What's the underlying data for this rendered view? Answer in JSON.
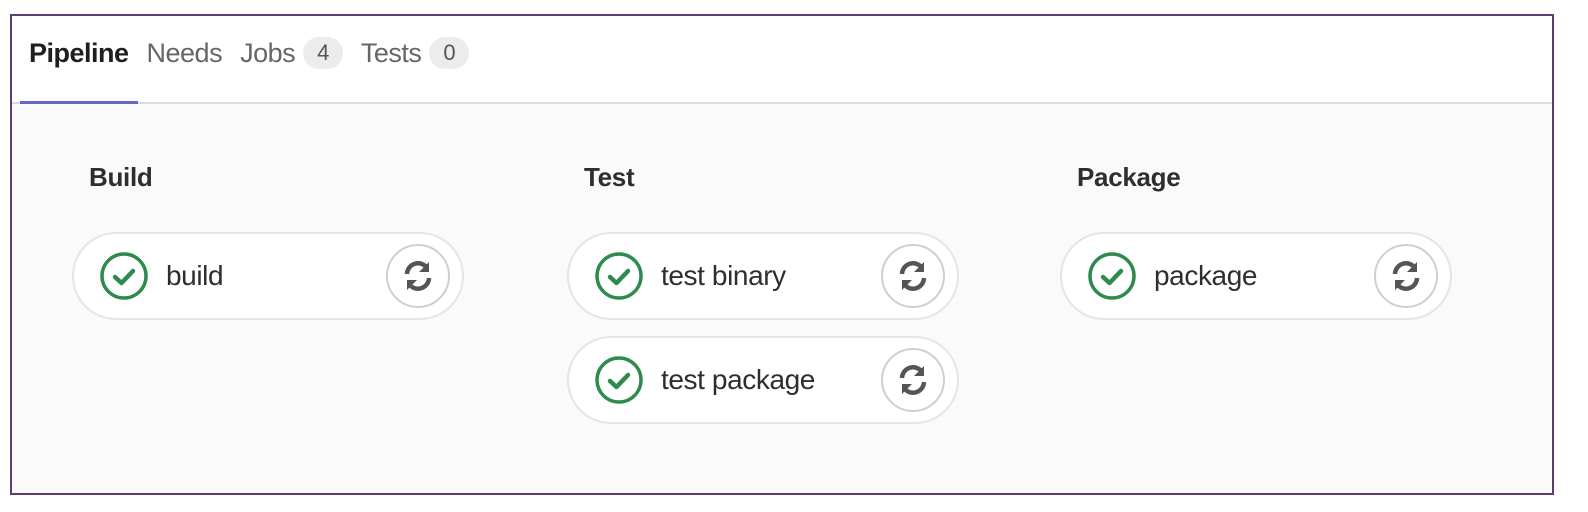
{
  "tabs": [
    {
      "label": "Pipeline",
      "active": true
    },
    {
      "label": "Needs",
      "active": false
    },
    {
      "label": "Jobs",
      "badge": "4",
      "active": false
    },
    {
      "label": "Tests",
      "badge": "0",
      "active": false
    }
  ],
  "stages": [
    {
      "title": "Build",
      "jobs": [
        {
          "name": "build",
          "status": "success",
          "action": "retry"
        }
      ]
    },
    {
      "title": "Test",
      "jobs": [
        {
          "name": "test binary",
          "status": "success",
          "action": "retry"
        },
        {
          "name": "test package",
          "status": "success",
          "action": "retry"
        }
      ]
    },
    {
      "title": "Package",
      "jobs": [
        {
          "name": "package",
          "status": "success",
          "action": "retry"
        }
      ]
    }
  ],
  "colors": {
    "success": "#2f8a4e",
    "active_tab_underline": "#6666c4",
    "frame": "#5e3d6e"
  },
  "icons": {
    "status": "check-circle-icon",
    "action": "retry-icon"
  }
}
